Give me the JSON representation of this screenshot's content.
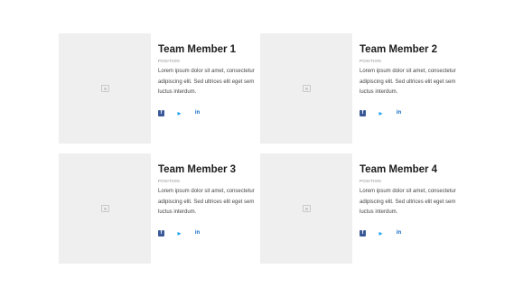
{
  "members": [
    {
      "name": "Team Member 1",
      "position": "POSITION",
      "bio": "Lorem ipsum dolor sit amet, consectetur adipiscing elit. Sed ultrices elit eget sem luctus interdum."
    },
    {
      "name": "Team Member 2",
      "position": "POSITION",
      "bio": "Lorem ipsum dolor sit amet, consectetur adipiscing elit. Sed ultrices elit eget sem luctus interdum."
    },
    {
      "name": "Team Member 3",
      "position": "POSITION",
      "bio": "Lorem ipsum dolor sit amet, consectetur adipiscing elit. Sed ultrices elit eget sem luctus interdum."
    },
    {
      "name": "Team Member 4",
      "position": "POSITION",
      "bio": "Lorem ipsum dolor sit amet, consectetur adipiscing elit. Sed ultrices elit eget sem luctus interdum."
    }
  ],
  "social": {
    "facebook_glyph": "f",
    "twitter_glyph": "🐦",
    "linkedin_glyph": "in",
    "icons": [
      "facebook-icon",
      "twitter-icon",
      "linkedin-icon"
    ]
  },
  "colors": {
    "photo_placeholder": "#efefef",
    "facebook": "#3b5998",
    "twitter": "#1da1f2",
    "linkedin": "#0a66c2"
  }
}
